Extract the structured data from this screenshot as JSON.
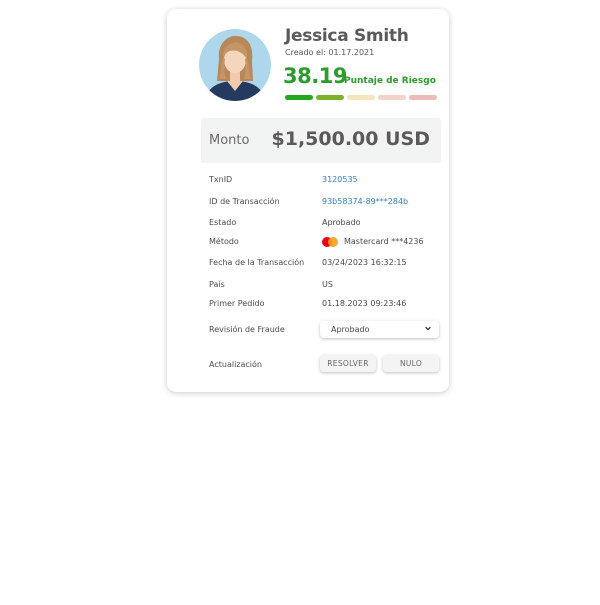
{
  "profile": {
    "name": "Jessica Smith",
    "created": "Creado el: 01.17.2021",
    "score": "38.19",
    "score_label": "Puntaje de Riesgo",
    "risk_level": 0.38,
    "risk_colors": [
      "#22a61e",
      "#7cb32b",
      "#f3e6c0",
      "#f3d3c8",
      "#ebbcba"
    ]
  },
  "amount": {
    "label": "Monto",
    "value": "$1,500.00 USD"
  },
  "details": {
    "txnid_label": "TxnID",
    "txnid_value": "3120535",
    "transaction_id_label": "ID de Transacción",
    "transaction_id_value": "93b58374-89***284b",
    "status_label": "Estado",
    "status_value": "Aprobado",
    "method_label": "Método",
    "method_value": "Mastercard ***4236",
    "date_label": "Fecha de la Transacción",
    "date_value": "03/24/2023 16:32:15",
    "country_label": "País",
    "country_value": "US",
    "first_order_label": "Primer Pedido",
    "first_order_value": "01.18.2023 09:23:46"
  },
  "fraud_review": {
    "label": "Revisión de Fraude",
    "selected": "Aprobado"
  },
  "update": {
    "label": "Actualización",
    "resolve_label": "RESOLVER",
    "void_label": "NULO"
  },
  "colors": {
    "accent_green": "#2a9d2a",
    "link_blue": "#2f7fc1",
    "avatar_bg": "#aed7ec"
  }
}
